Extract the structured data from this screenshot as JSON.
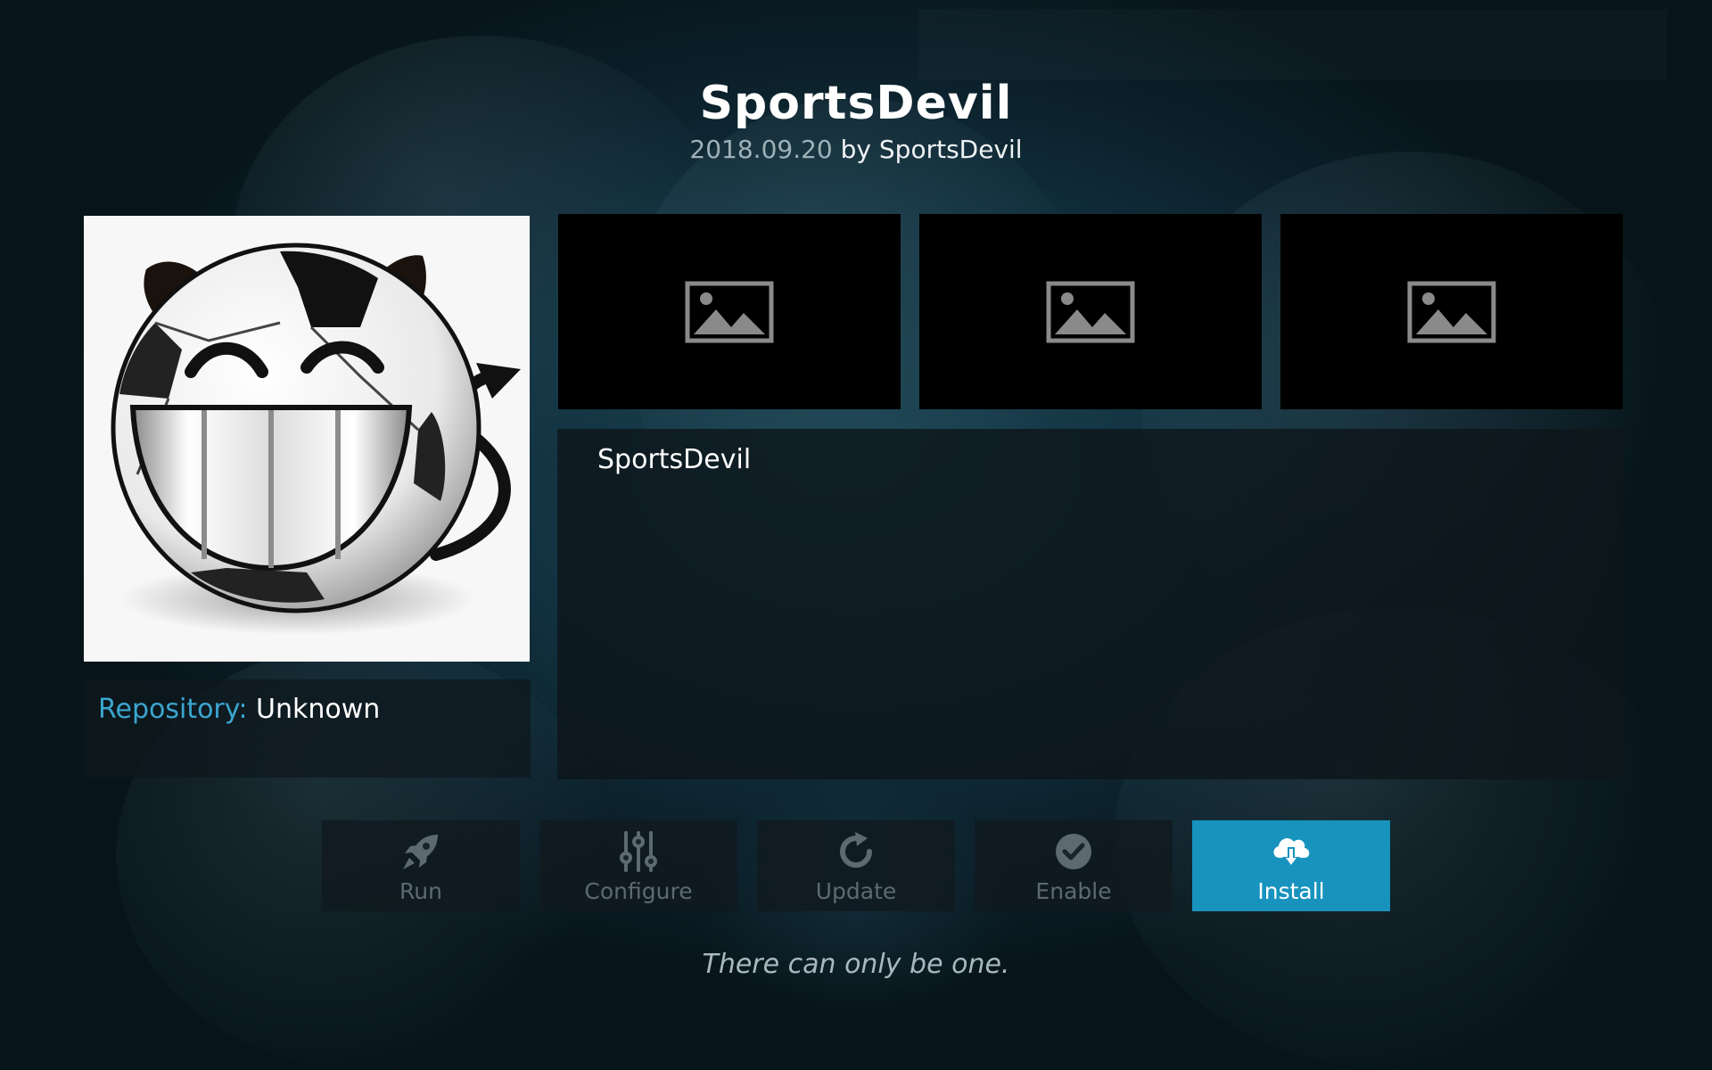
{
  "addon": {
    "title": "SportsDevil",
    "version": "2018.09.20",
    "by_text": "by SportsDevil",
    "description_title": "SportsDevil",
    "tagline": "There can only be one."
  },
  "repository": {
    "label": "Repository:",
    "value": "Unknown"
  },
  "screenshots": [
    {
      "icon": "image-placeholder-icon"
    },
    {
      "icon": "image-placeholder-icon"
    },
    {
      "icon": "image-placeholder-icon"
    }
  ],
  "buttons": [
    {
      "label": "Run",
      "icon": "rocket-icon",
      "enabled": false
    },
    {
      "label": "Configure",
      "icon": "sliders-icon",
      "enabled": false
    },
    {
      "label": "Update",
      "icon": "refresh-icon",
      "enabled": false
    },
    {
      "label": "Enable",
      "icon": "check-circle-icon",
      "enabled": false
    },
    {
      "label": "Install",
      "icon": "cloud-download-icon",
      "enabled": true,
      "focused": true
    }
  ],
  "colors": {
    "accent": "#1793be",
    "repo_label": "#3ba6cf",
    "disabled_text": "#5d6a70"
  }
}
